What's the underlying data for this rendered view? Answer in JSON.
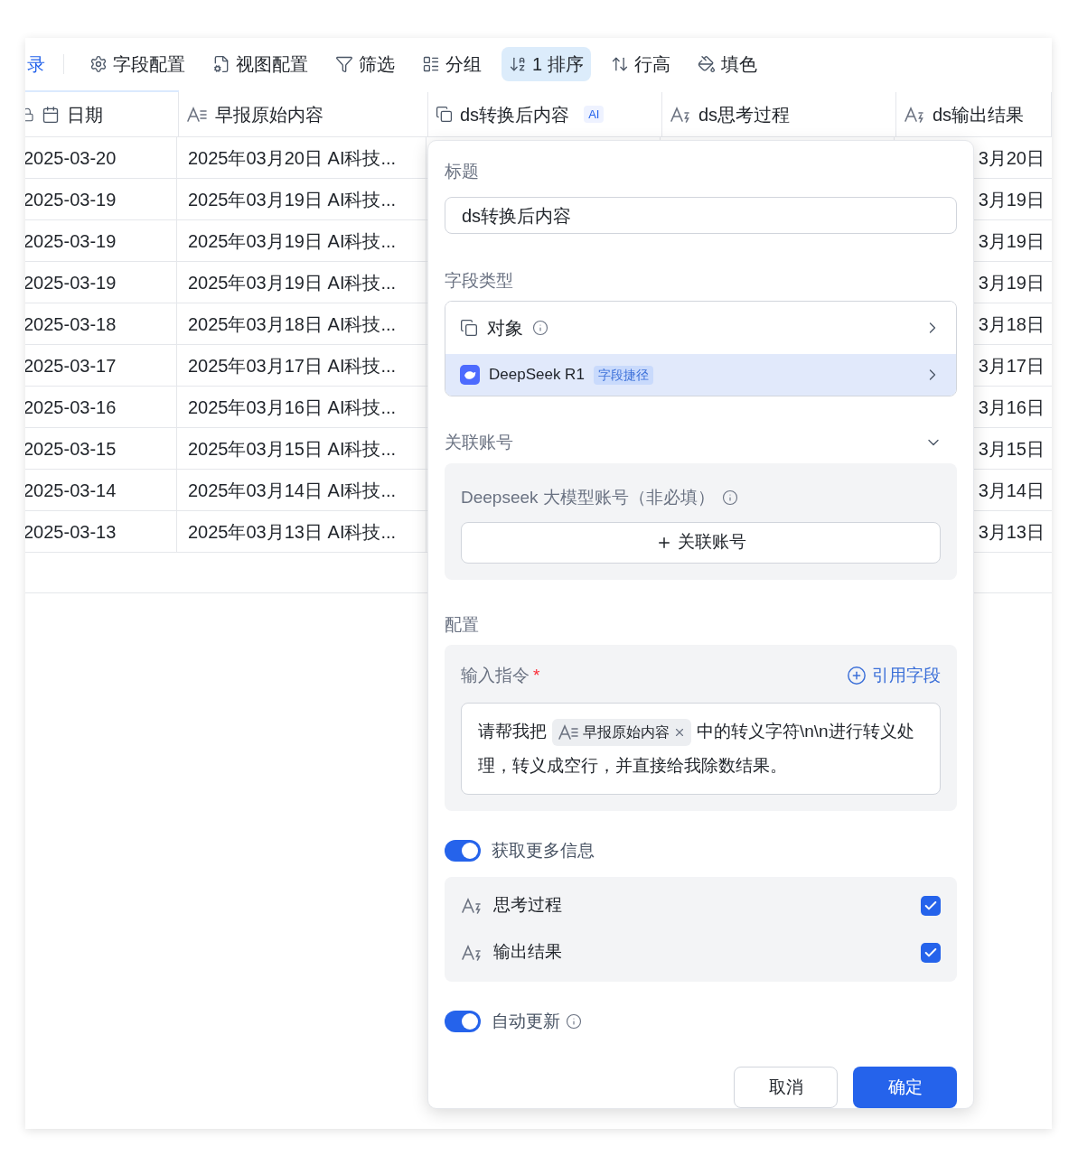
{
  "toolbar": {
    "cut_label": "录",
    "items": [
      {
        "kind": "settings",
        "label": "字段配置",
        "selected": false
      },
      {
        "kind": "view",
        "label": "视图配置",
        "selected": false
      },
      {
        "kind": "filter",
        "label": "筛选",
        "selected": false
      },
      {
        "kind": "group",
        "label": "分组",
        "selected": false
      },
      {
        "kind": "sort",
        "label": "1 排序",
        "selected": true
      },
      {
        "kind": "height",
        "label": "行高",
        "selected": false
      },
      {
        "kind": "fill",
        "label": "填色",
        "selected": false
      }
    ]
  },
  "table": {
    "columns": [
      {
        "kind": "date",
        "label": "日期"
      },
      {
        "kind": "text",
        "label": "早报原始内容"
      },
      {
        "kind": "object",
        "label": "ds转换后内容",
        "badge": "AI"
      },
      {
        "kind": "ai_text",
        "label": "ds思考过程"
      },
      {
        "kind": "ai_text",
        "label": "ds输出结果"
      }
    ],
    "rows": [
      {
        "date": "2025-03-20",
        "content": "2025年03月20日 AI科技...",
        "column_5": "3月20日"
      },
      {
        "date": "2025-03-19",
        "content": "2025年03月19日 AI科技...",
        "column_5": "3月19日"
      },
      {
        "date": "2025-03-19",
        "content": "2025年03月19日 AI科技...",
        "column_5": "3月19日"
      },
      {
        "date": "2025-03-19",
        "content": "2025年03月19日 AI科技...",
        "column_5": "3月19日"
      },
      {
        "date": "2025-03-18",
        "content": "2025年03月18日 AI科技...",
        "column_5": "3月18日"
      },
      {
        "date": "2025-03-17",
        "content": "2025年03月17日 AI科技...",
        "column_5": "3月17日"
      },
      {
        "date": "2025-03-16",
        "content": "2025年03月16日 AI科技...",
        "column_5": "3月16日"
      },
      {
        "date": "2025-03-15",
        "content": "2025年03月15日 AI科技...",
        "column_5": "3月15日"
      },
      {
        "date": "2025-03-14",
        "content": "2025年03月14日 AI科技...",
        "column_5": "3月14日"
      },
      {
        "date": "2025-03-13",
        "content": "2025年03月13日 AI科技...",
        "column_5": "3月13日"
      }
    ]
  },
  "dialog": {
    "title_label": "标题",
    "title_value": "ds转换后内容",
    "field_type_label": "字段类型",
    "field_types": [
      {
        "kind": "object",
        "label": "对象",
        "selected": false
      },
      {
        "kind": "deepseek",
        "label": "DeepSeek R1",
        "tag": "字段捷径",
        "selected": true
      }
    ],
    "account_label": "关联账号",
    "account_field_label": "Deepseek 大模型账号（非必填）",
    "link_account_button": "关联账号",
    "config_label": "配置",
    "instruction_label": "输入指令",
    "required_mark": "*",
    "cite_field_link": "引用字段",
    "instruction": {
      "before": "请帮我把",
      "chip": "早报原始内容",
      "after": "中的转义字符\\n\\n进行转义处理，转义成空行，并直接给我除数结果。"
    },
    "more_info": {
      "label": "获取更多信息",
      "on": true
    },
    "outputs": [
      {
        "label": "思考过程",
        "checked": true
      },
      {
        "label": "输出结果",
        "checked": true
      }
    ],
    "auto_update": {
      "label": "自动更新",
      "on": true
    },
    "buttons": {
      "cancel": "取消",
      "confirm": "确定"
    }
  }
}
